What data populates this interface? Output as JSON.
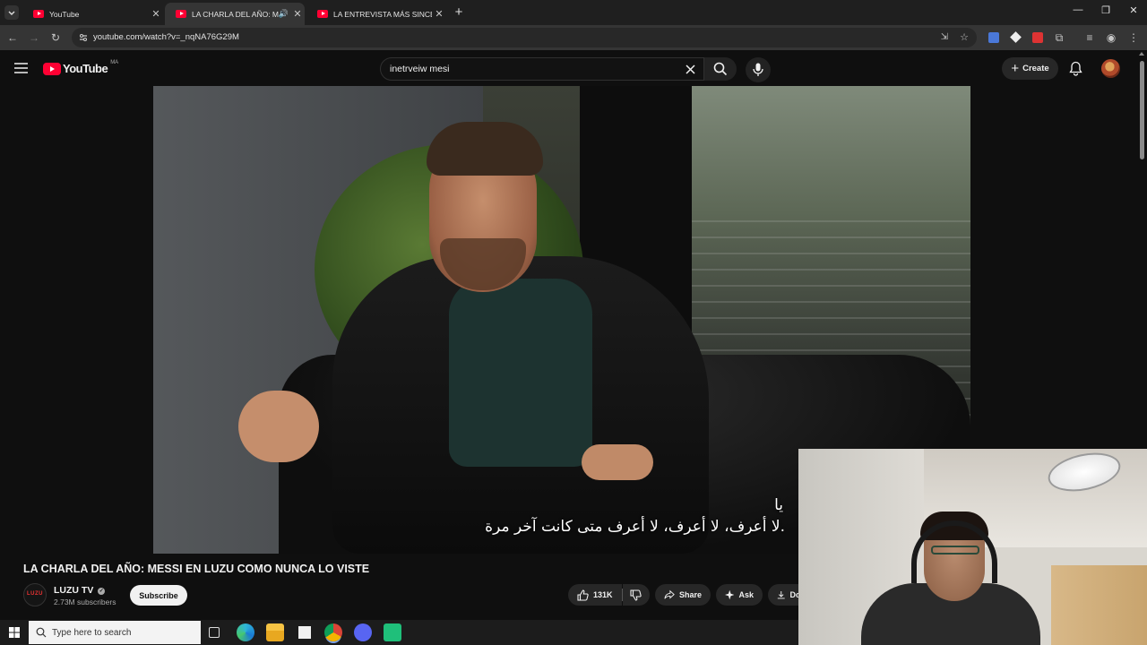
{
  "browser": {
    "tabs": [
      {
        "title": "YouTube",
        "active": false
      },
      {
        "title": "LA CHARLA DEL AÑO: MES",
        "active": true
      },
      {
        "title": "LA ENTREVISTA MÁS SINCERA",
        "active": false
      }
    ],
    "new_tab_icon": "plus-icon",
    "url": "youtube.com/watch?v=_nqNA76G29M"
  },
  "youtube": {
    "logo_text": "YouTube",
    "region_badge": "MA",
    "search_value": "inetrveiw mesi",
    "create_label": "Create"
  },
  "video": {
    "subtitle_line1": "يا",
    "subtitle_line2": "لا أعرف، لا أعرف، لا أعرف متى كانت آخر مرة."
  },
  "info": {
    "title": "LA CHARLA DEL AÑO: MESSI EN LUZU COMO NUNCA LO VISTE",
    "channel_name": "LUZU TV",
    "channel_logo_text": "LUZU",
    "subscribers": "2.73M subscribers",
    "subscribe_label": "Subscribe",
    "likes": "131K",
    "share_label": "Share",
    "ask_label": "Ask",
    "download_label": "Do"
  },
  "taskbar": {
    "search_placeholder": "Type here to search"
  },
  "colors": {
    "yt_red": "#ff0033",
    "page_bg": "#0f0f0f",
    "pill_bg": "#272727"
  }
}
